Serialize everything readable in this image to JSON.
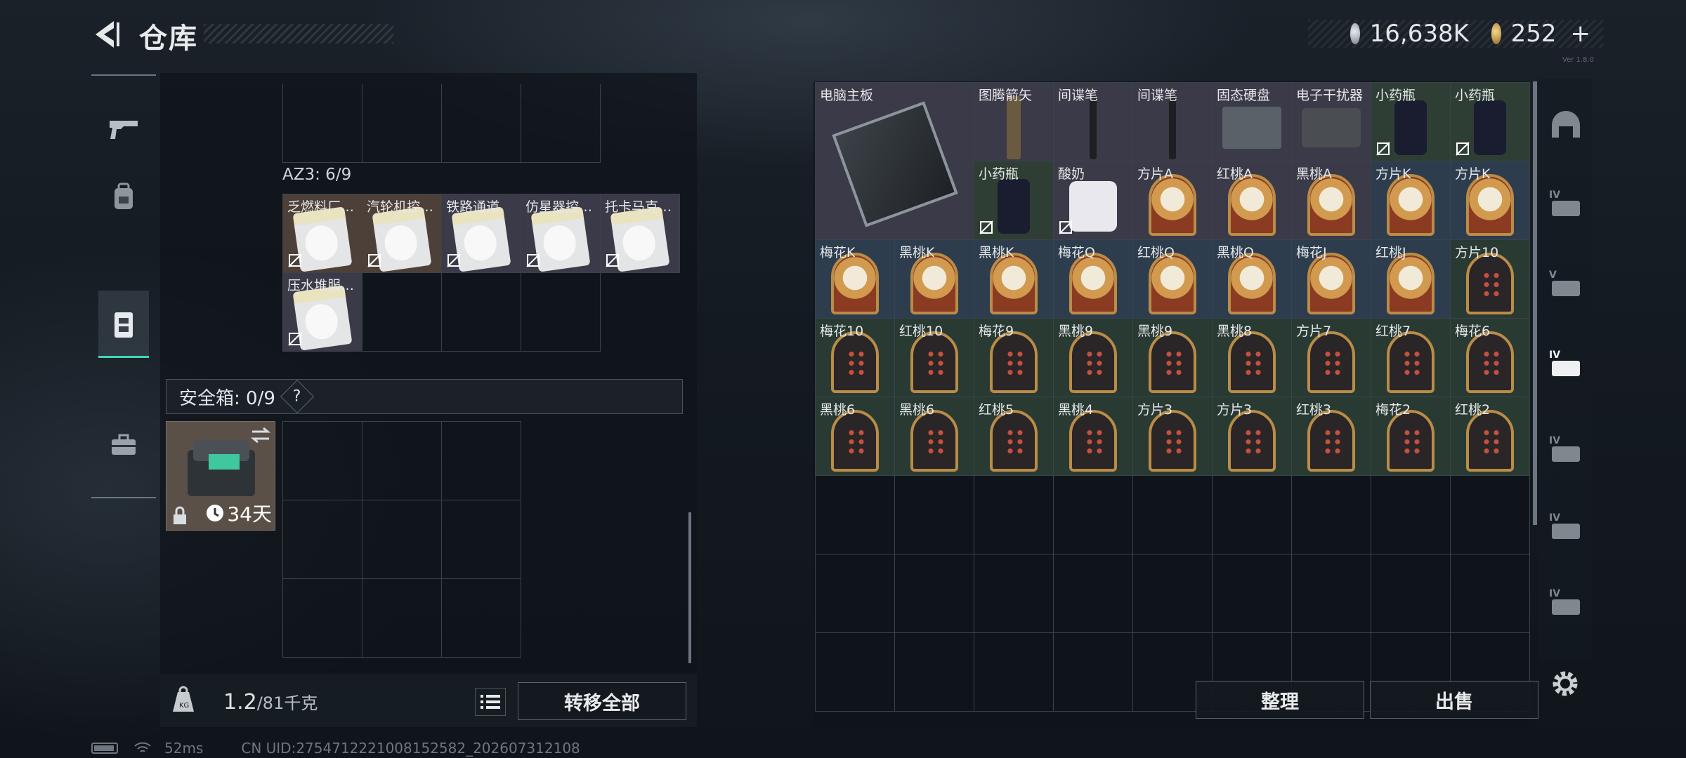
{
  "header": {
    "title": "仓库",
    "currency1_value": "16,638K",
    "currency2_value": "252",
    "currency2_add": "+",
    "version": "Ver 1.8.0"
  },
  "icons": {
    "back": "back-arrow-icon",
    "currency1": "silver-coin-icon",
    "currency2": "gold-coin-icon"
  },
  "left_nav": [
    "weapon-icon",
    "backpack-icon",
    "rig-icon",
    "case-icon"
  ],
  "az3": {
    "label": "AZ3: 6/9",
    "items": [
      "乏燃料厂…",
      "汽轮机控…",
      "铁路通道",
      "仿星器控…",
      "托卡马克…",
      "压水堆服…"
    ]
  },
  "safe": {
    "label": "安全箱: 0/9",
    "help": "?",
    "days": "34天"
  },
  "bottom": {
    "weight_current": "1.2",
    "weight_max": "/81千克",
    "transfer_all": "转移全部",
    "organize": "整理",
    "sell": "出售"
  },
  "status": {
    "ping": "52ms",
    "uid": "CN UID:2754712221008152582_202607312108"
  },
  "stash_items": {
    "row0": [
      "电脑主板",
      "图腾箭矢",
      "间谍笔",
      "间谍笔",
      "固态硬盘",
      "电子干扰器",
      "小药瓶",
      "小药瓶"
    ],
    "row1": [
      "小药瓶",
      "酸奶",
      "方片A",
      "红桃A",
      "黑桃A",
      "方片K",
      "方片K"
    ],
    "row2": [
      "梅花K",
      "黑桃K",
      "黑桃K",
      "梅花Q",
      "红桃Q",
      "黑桃Q",
      "梅花J",
      "红桃J",
      "方片10"
    ],
    "row3": [
      "梅花10",
      "红桃10",
      "梅花9",
      "黑桃9",
      "黑桃9",
      "黑桃8",
      "方片7",
      "红桃7",
      "梅花6"
    ],
    "row4": [
      "黑桃6",
      "黑桃6",
      "红桃5",
      "黑桃4",
      "方片3",
      "方片3",
      "红桃3",
      "梅花2",
      "红桃2"
    ]
  },
  "right_tabs": [
    "helmet-icon",
    "armor-iv-icon",
    "case-v-icon",
    "case-iv-active-icon",
    "case-iv-icon",
    "folder-iv-icon",
    "folder-iv-2-icon"
  ],
  "colors": {
    "accent": "#3fd8b5",
    "brown": "#4d4038",
    "purple": "#3b3a48",
    "green": "#2f3e34",
    "blue": "#2d3d4d"
  }
}
